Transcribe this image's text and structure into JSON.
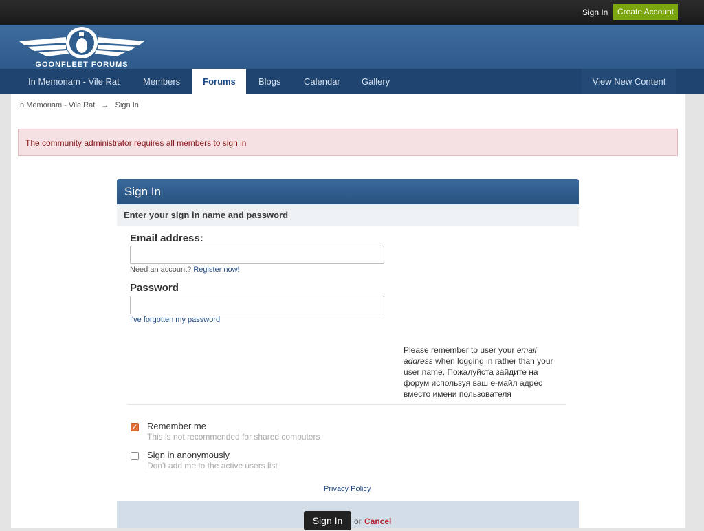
{
  "topbar": {
    "sign_in": "Sign In",
    "create_account": "Create Account"
  },
  "logo": {
    "text": "GOONFLEET FORUMS"
  },
  "nav": {
    "items": [
      "In Memoriam - Vile Rat",
      "Members",
      "Forums",
      "Blogs",
      "Calendar",
      "Gallery"
    ],
    "active": "Forums",
    "view_new_content": "View New Content"
  },
  "breadcrumb": {
    "items": [
      "In Memoriam - Vile Rat",
      "Sign In"
    ],
    "separator": "→"
  },
  "alert": "The community administrator requires all members to sign in",
  "signin": {
    "title": "Sign In",
    "subtitle": "Enter your sign in name and password",
    "email_label": "Email address:",
    "email_value": "",
    "need_account": "Need an account?",
    "register": "Register now!",
    "password_label": "Password",
    "password_value": "",
    "forgot": "I've forgotten my password",
    "note_pre": "Please remember to user your ",
    "note_em": "email address",
    "note_post": " when logging in rather than your user name. Пожалуйста зайдите на форум используя ваш е-майл адрес вместо имени пользователя",
    "remember_label": "Remember me",
    "remember_desc": "This is not recommended for shared computers",
    "remember_checked": true,
    "anon_label": "Sign in anonymously",
    "anon_desc": "Don't add me to the active users list",
    "anon_checked": false,
    "privacy": "Privacy Policy",
    "submit": "Sign In",
    "or": "or",
    "cancel": "Cancel"
  },
  "colors": {
    "accent": "#7ba60d",
    "nav": "#1f4470",
    "header": "#2d5a8a",
    "cancel": "#b8202b"
  }
}
